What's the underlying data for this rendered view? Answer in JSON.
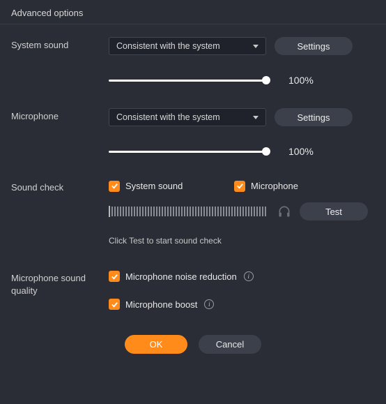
{
  "title": "Advanced options",
  "system_sound": {
    "label": "System sound",
    "device": "Consistent with the system",
    "settings_btn": "Settings",
    "volume_pct": "100%"
  },
  "microphone": {
    "label": "Microphone",
    "device": "Consistent with the system",
    "settings_btn": "Settings",
    "volume_pct": "100%"
  },
  "sound_check": {
    "label": "Sound check",
    "cb_system": "System sound",
    "cb_mic": "Microphone",
    "test_btn": "Test",
    "hint": "Click Test to start sound check"
  },
  "quality": {
    "label": "Microphone sound quality",
    "noise_reduction": "Microphone noise reduction",
    "boost": "Microphone boost"
  },
  "footer": {
    "ok": "OK",
    "cancel": "Cancel"
  },
  "colors": {
    "accent": "#ff8c1a",
    "bg": "#2a2d36"
  }
}
